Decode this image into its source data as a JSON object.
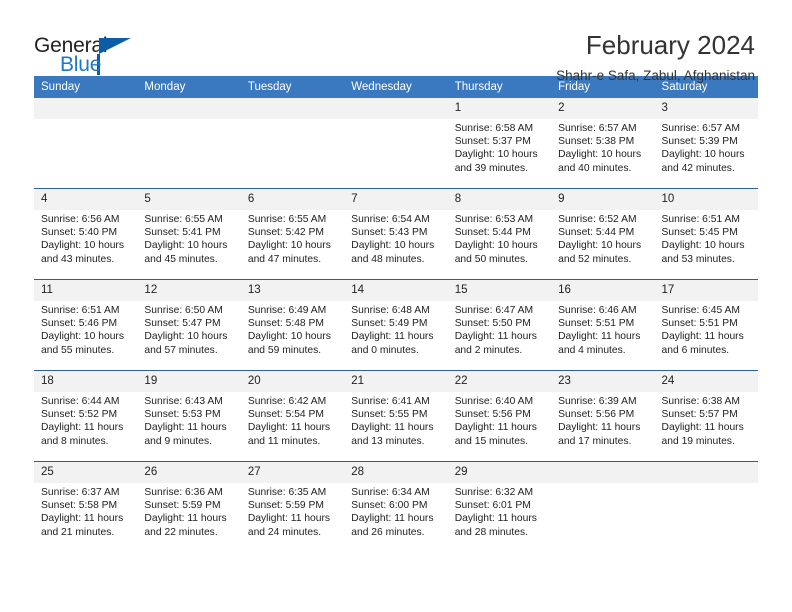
{
  "logo": {
    "line1": "General",
    "line2": "Blue",
    "accent_color": "#0c5ca8",
    "blue_text_color": "#1f7ac4"
  },
  "header": {
    "title": "February 2024",
    "subtitle": "Shahr-e Safa, Zabul, Afghanistan"
  },
  "theme": {
    "header_bg": "#3a79bf",
    "header_text": "#ffffff",
    "row_divider": "#2f5f96",
    "daynum_bg": "#f2f2f2"
  },
  "calendar": {
    "weekday_headers": [
      "Sunday",
      "Monday",
      "Tuesday",
      "Wednesday",
      "Thursday",
      "Friday",
      "Saturday"
    ],
    "weeks": [
      [
        {
          "day": "",
          "sunrise": "",
          "sunset": "",
          "daylight": "",
          "empty": true
        },
        {
          "day": "",
          "sunrise": "",
          "sunset": "",
          "daylight": "",
          "empty": true
        },
        {
          "day": "",
          "sunrise": "",
          "sunset": "",
          "daylight": "",
          "empty": true
        },
        {
          "day": "",
          "sunrise": "",
          "sunset": "",
          "daylight": "",
          "empty": true
        },
        {
          "day": "1",
          "sunrise": "Sunrise: 6:58 AM",
          "sunset": "Sunset: 5:37 PM",
          "daylight": "Daylight: 10 hours and 39 minutes.",
          "empty": false
        },
        {
          "day": "2",
          "sunrise": "Sunrise: 6:57 AM",
          "sunset": "Sunset: 5:38 PM",
          "daylight": "Daylight: 10 hours and 40 minutes.",
          "empty": false
        },
        {
          "day": "3",
          "sunrise": "Sunrise: 6:57 AM",
          "sunset": "Sunset: 5:39 PM",
          "daylight": "Daylight: 10 hours and 42 minutes.",
          "empty": false
        }
      ],
      [
        {
          "day": "4",
          "sunrise": "Sunrise: 6:56 AM",
          "sunset": "Sunset: 5:40 PM",
          "daylight": "Daylight: 10 hours and 43 minutes.",
          "empty": false
        },
        {
          "day": "5",
          "sunrise": "Sunrise: 6:55 AM",
          "sunset": "Sunset: 5:41 PM",
          "daylight": "Daylight: 10 hours and 45 minutes.",
          "empty": false
        },
        {
          "day": "6",
          "sunrise": "Sunrise: 6:55 AM",
          "sunset": "Sunset: 5:42 PM",
          "daylight": "Daylight: 10 hours and 47 minutes.",
          "empty": false
        },
        {
          "day": "7",
          "sunrise": "Sunrise: 6:54 AM",
          "sunset": "Sunset: 5:43 PM",
          "daylight": "Daylight: 10 hours and 48 minutes.",
          "empty": false
        },
        {
          "day": "8",
          "sunrise": "Sunrise: 6:53 AM",
          "sunset": "Sunset: 5:44 PM",
          "daylight": "Daylight: 10 hours and 50 minutes.",
          "empty": false
        },
        {
          "day": "9",
          "sunrise": "Sunrise: 6:52 AM",
          "sunset": "Sunset: 5:44 PM",
          "daylight": "Daylight: 10 hours and 52 minutes.",
          "empty": false
        },
        {
          "day": "10",
          "sunrise": "Sunrise: 6:51 AM",
          "sunset": "Sunset: 5:45 PM",
          "daylight": "Daylight: 10 hours and 53 minutes.",
          "empty": false
        }
      ],
      [
        {
          "day": "11",
          "sunrise": "Sunrise: 6:51 AM",
          "sunset": "Sunset: 5:46 PM",
          "daylight": "Daylight: 10 hours and 55 minutes.",
          "empty": false
        },
        {
          "day": "12",
          "sunrise": "Sunrise: 6:50 AM",
          "sunset": "Sunset: 5:47 PM",
          "daylight": "Daylight: 10 hours and 57 minutes.",
          "empty": false
        },
        {
          "day": "13",
          "sunrise": "Sunrise: 6:49 AM",
          "sunset": "Sunset: 5:48 PM",
          "daylight": "Daylight: 10 hours and 59 minutes.",
          "empty": false
        },
        {
          "day": "14",
          "sunrise": "Sunrise: 6:48 AM",
          "sunset": "Sunset: 5:49 PM",
          "daylight": "Daylight: 11 hours and 0 minutes.",
          "empty": false
        },
        {
          "day": "15",
          "sunrise": "Sunrise: 6:47 AM",
          "sunset": "Sunset: 5:50 PM",
          "daylight": "Daylight: 11 hours and 2 minutes.",
          "empty": false
        },
        {
          "day": "16",
          "sunrise": "Sunrise: 6:46 AM",
          "sunset": "Sunset: 5:51 PM",
          "daylight": "Daylight: 11 hours and 4 minutes.",
          "empty": false
        },
        {
          "day": "17",
          "sunrise": "Sunrise: 6:45 AM",
          "sunset": "Sunset: 5:51 PM",
          "daylight": "Daylight: 11 hours and 6 minutes.",
          "empty": false
        }
      ],
      [
        {
          "day": "18",
          "sunrise": "Sunrise: 6:44 AM",
          "sunset": "Sunset: 5:52 PM",
          "daylight": "Daylight: 11 hours and 8 minutes.",
          "empty": false
        },
        {
          "day": "19",
          "sunrise": "Sunrise: 6:43 AM",
          "sunset": "Sunset: 5:53 PM",
          "daylight": "Daylight: 11 hours and 9 minutes.",
          "empty": false
        },
        {
          "day": "20",
          "sunrise": "Sunrise: 6:42 AM",
          "sunset": "Sunset: 5:54 PM",
          "daylight": "Daylight: 11 hours and 11 minutes.",
          "empty": false
        },
        {
          "day": "21",
          "sunrise": "Sunrise: 6:41 AM",
          "sunset": "Sunset: 5:55 PM",
          "daylight": "Daylight: 11 hours and 13 minutes.",
          "empty": false
        },
        {
          "day": "22",
          "sunrise": "Sunrise: 6:40 AM",
          "sunset": "Sunset: 5:56 PM",
          "daylight": "Daylight: 11 hours and 15 minutes.",
          "empty": false
        },
        {
          "day": "23",
          "sunrise": "Sunrise: 6:39 AM",
          "sunset": "Sunset: 5:56 PM",
          "daylight": "Daylight: 11 hours and 17 minutes.",
          "empty": false
        },
        {
          "day": "24",
          "sunrise": "Sunrise: 6:38 AM",
          "sunset": "Sunset: 5:57 PM",
          "daylight": "Daylight: 11 hours and 19 minutes.",
          "empty": false
        }
      ],
      [
        {
          "day": "25",
          "sunrise": "Sunrise: 6:37 AM",
          "sunset": "Sunset: 5:58 PM",
          "daylight": "Daylight: 11 hours and 21 minutes.",
          "empty": false
        },
        {
          "day": "26",
          "sunrise": "Sunrise: 6:36 AM",
          "sunset": "Sunset: 5:59 PM",
          "daylight": "Daylight: 11 hours and 22 minutes.",
          "empty": false
        },
        {
          "day": "27",
          "sunrise": "Sunrise: 6:35 AM",
          "sunset": "Sunset: 5:59 PM",
          "daylight": "Daylight: 11 hours and 24 minutes.",
          "empty": false
        },
        {
          "day": "28",
          "sunrise": "Sunrise: 6:34 AM",
          "sunset": "Sunset: 6:00 PM",
          "daylight": "Daylight: 11 hours and 26 minutes.",
          "empty": false
        },
        {
          "day": "29",
          "sunrise": "Sunrise: 6:32 AM",
          "sunset": "Sunset: 6:01 PM",
          "daylight": "Daylight: 11 hours and 28 minutes.",
          "empty": false
        },
        {
          "day": "",
          "sunrise": "",
          "sunset": "",
          "daylight": "",
          "empty": true
        },
        {
          "day": "",
          "sunrise": "",
          "sunset": "",
          "daylight": "",
          "empty": true
        }
      ]
    ]
  }
}
